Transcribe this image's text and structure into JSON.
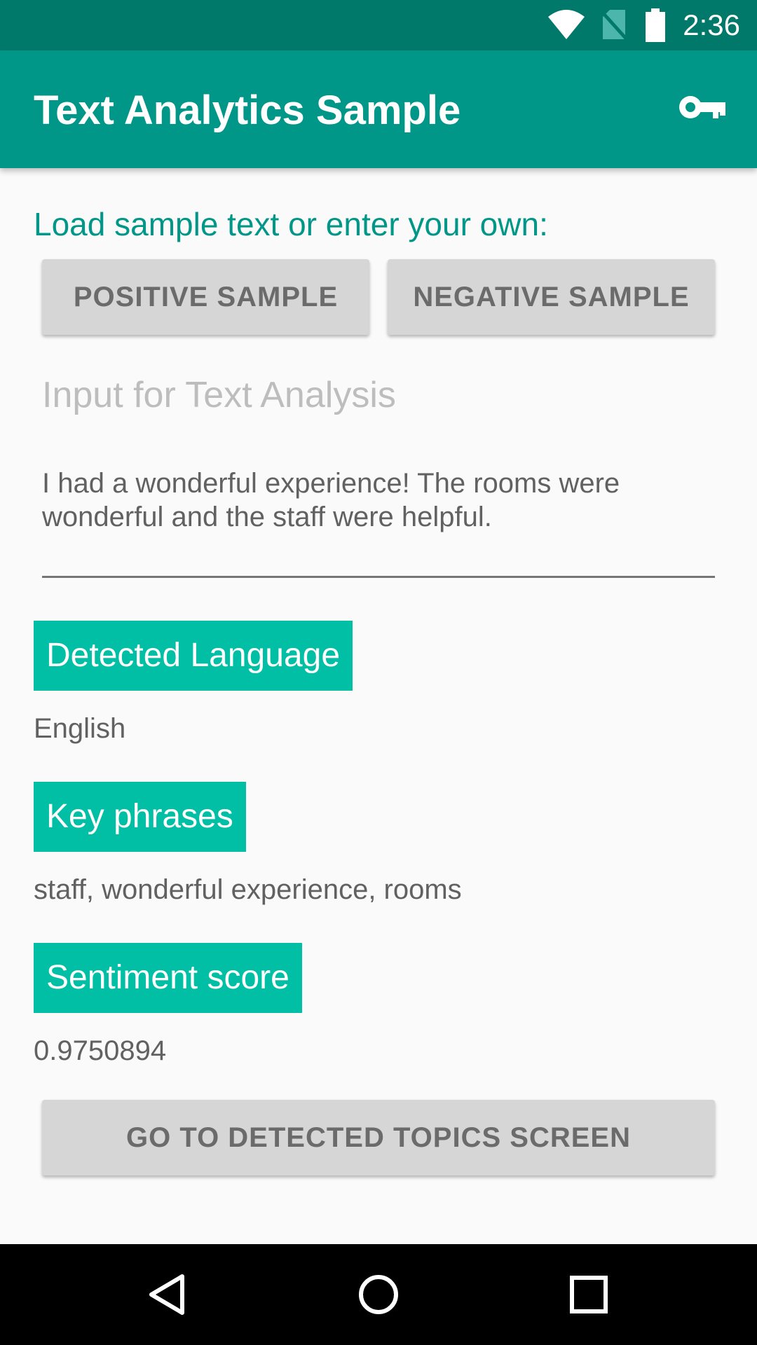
{
  "status_bar": {
    "time": "2:36",
    "icons": [
      "wifi-icon",
      "no-sim-icon",
      "battery-icon"
    ],
    "color": "#00796b"
  },
  "app_bar": {
    "title": "Text Analytics Sample",
    "action_icon": "key-icon",
    "color": "#009688"
  },
  "main": {
    "prompt": "Load sample text or enter your own:",
    "positive_sample_label": "POSITIVE SAMPLE",
    "negative_sample_label": "NEGATIVE SAMPLE",
    "input_hint": "Input for Text Analysis",
    "input_value": "I had a wonderful experience! The rooms were wonderful and the staff were helpful.",
    "sections": {
      "language": {
        "heading": "Detected Language",
        "value": "English"
      },
      "key_phrases": {
        "heading": "Key phrases",
        "value": "staff, wonderful experience, rooms"
      },
      "sentiment": {
        "heading": "Sentiment score",
        "value": "0.9750894"
      }
    },
    "topics_button_label": "GO TO DETECTED TOPICS SCREEN",
    "accent_color": "#00bfa5"
  },
  "nav_bar": {
    "icons": [
      "back-icon",
      "home-icon",
      "recents-icon"
    ]
  }
}
